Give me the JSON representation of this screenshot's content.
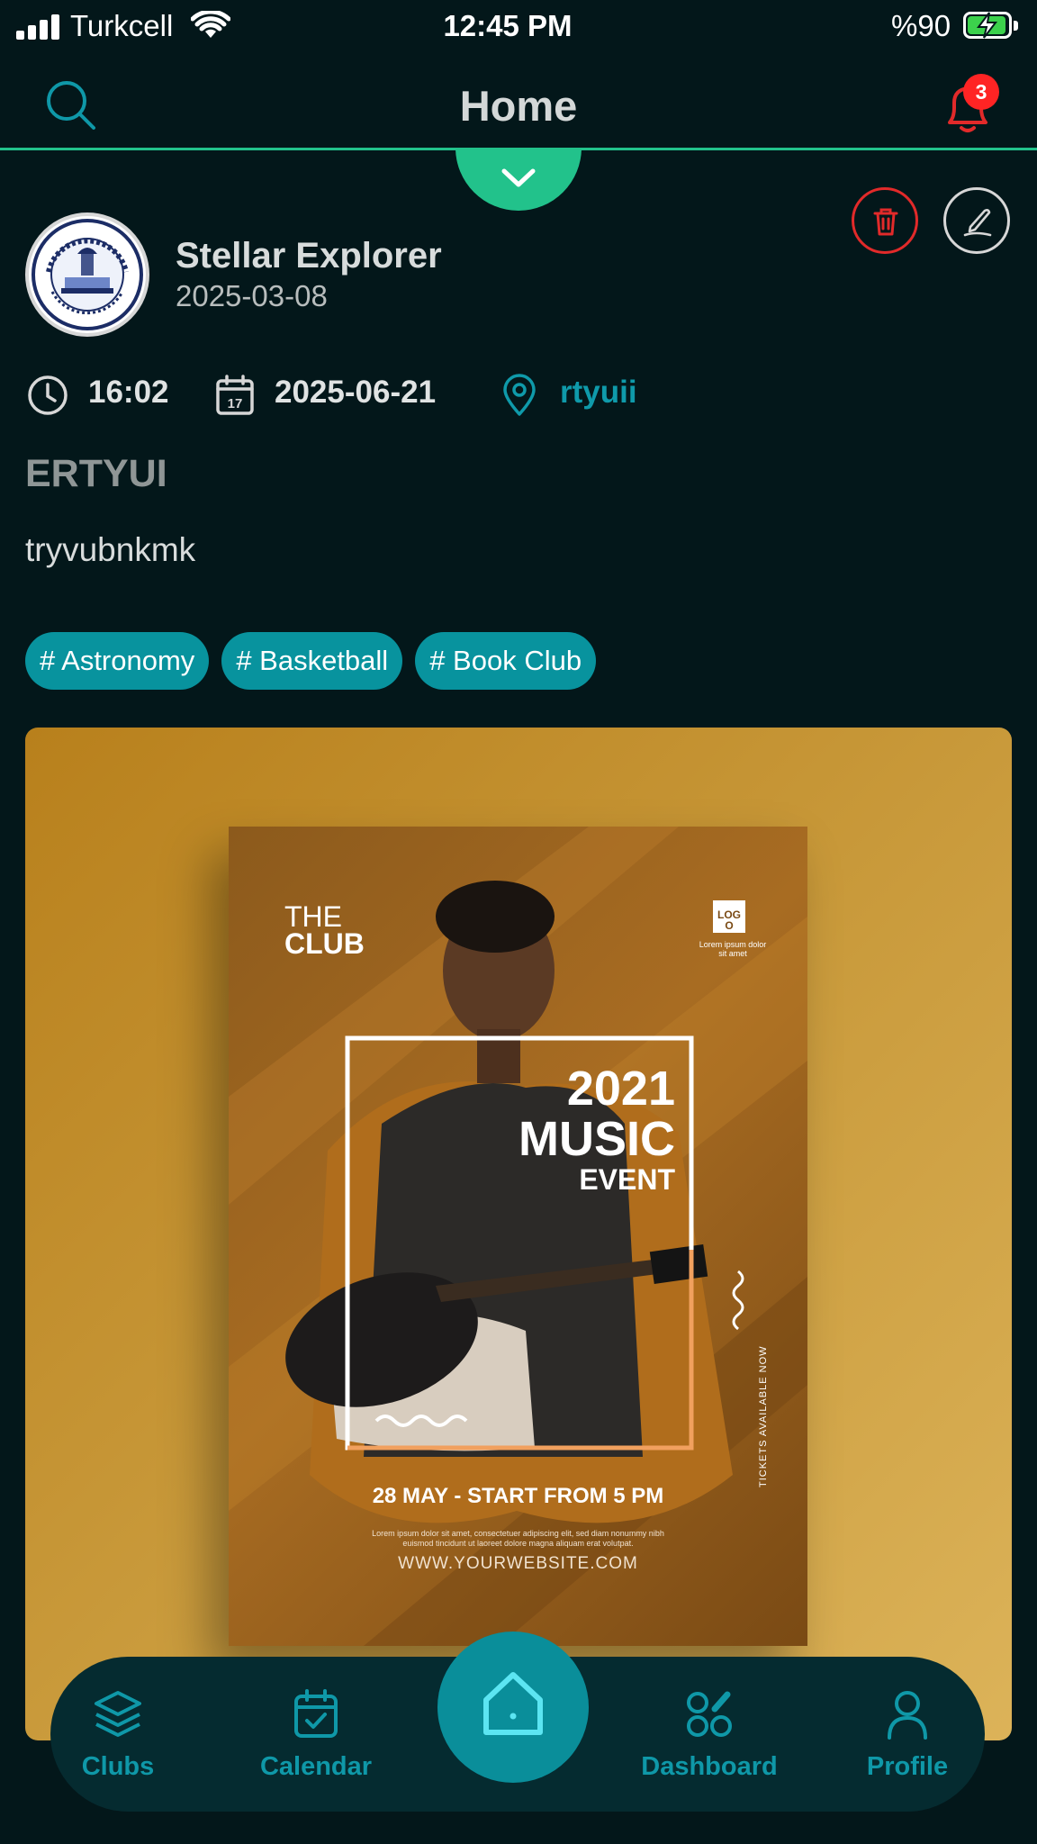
{
  "status_bar": {
    "carrier": "Turkcell",
    "time": "12:45 PM",
    "battery": "%90"
  },
  "header": {
    "title": "Home",
    "notification_count": "3",
    "accent_color": "#22c28b"
  },
  "post": {
    "club_name": "Stellar Explorer",
    "posted_date": "2025-03-08",
    "time": "16:02",
    "date": "2025-06-21",
    "location": "rtyuii",
    "title": "ERTYUI",
    "description": "tryvubnkmk",
    "tags": [
      "# Astronomy",
      "# Basketball",
      "# Book Club"
    ]
  },
  "poster": {
    "brand_line1": "THE",
    "brand_line2": "CLUB",
    "logo_text": "LOGO",
    "logo_sub": "Lorem ipsum dolor sit amet",
    "year": "2021",
    "headline": "MUSIC",
    "subhead": "EVENT",
    "side_text": "TICKETS AVAILABLE NOW",
    "schedule": "28 MAY - START FROM 5 PM",
    "body": "Lorem ipsum dolor sit amet, consectetuer adipiscing elit, sed diam nonummy nibh euismod tincidunt ut laoreet dolore magna aliquam erat volutpat.",
    "website": "WWW.YOURWEBSITE.COM"
  },
  "bottom_nav": {
    "items": [
      {
        "label": "Clubs",
        "icon": "layers-icon"
      },
      {
        "label": "Calendar",
        "icon": "calendar-check-icon"
      },
      {
        "label": "",
        "icon": "home-icon"
      },
      {
        "label": "Dashboard",
        "icon": "dashboard-icon"
      },
      {
        "label": "Profile",
        "icon": "profile-icon"
      }
    ]
  }
}
